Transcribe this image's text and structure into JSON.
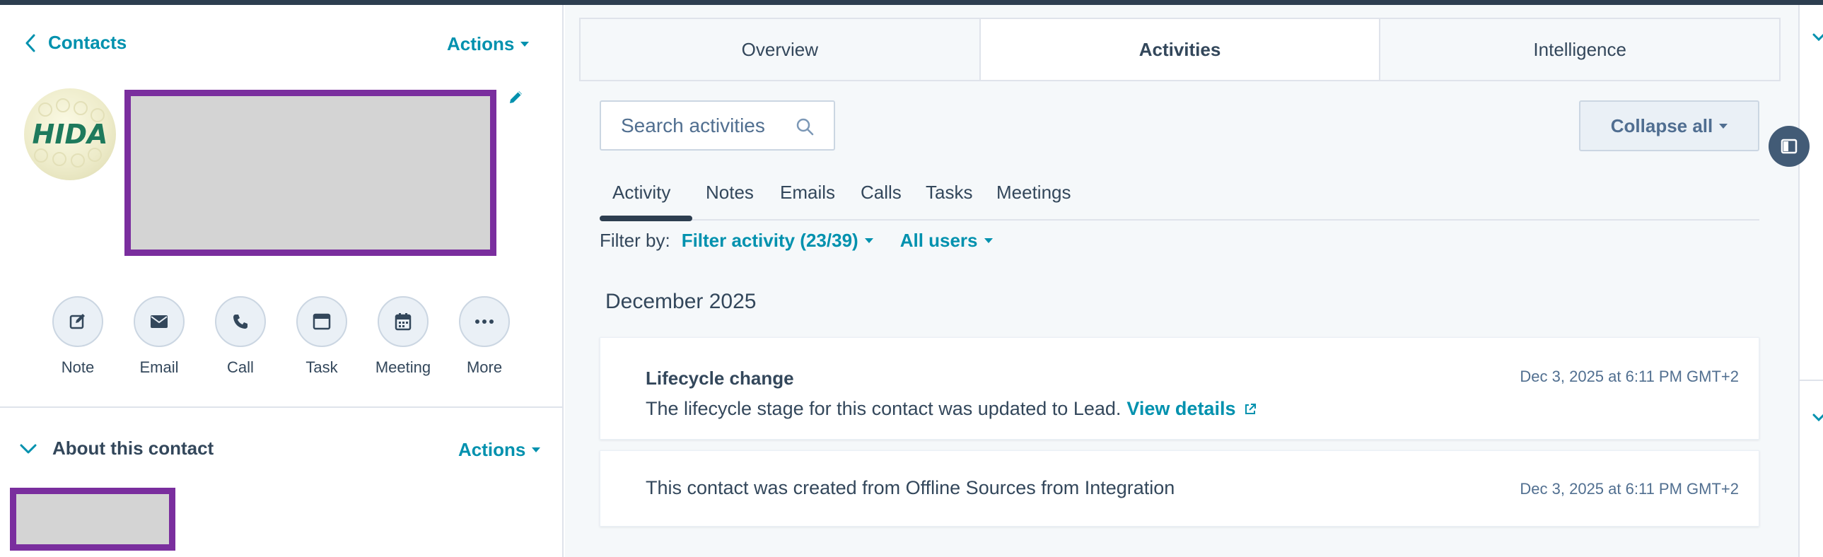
{
  "left_panel": {
    "back_label": "Contacts",
    "header_actions_label": "Actions",
    "logo_text": "HIDA",
    "quick_actions": [
      {
        "label": "Note",
        "icon": "note-icon"
      },
      {
        "label": "Email",
        "icon": "email-icon"
      },
      {
        "label": "Call",
        "icon": "phone-icon"
      },
      {
        "label": "Task",
        "icon": "task-icon"
      },
      {
        "label": "Meeting",
        "icon": "calendar-icon"
      },
      {
        "label": "More",
        "icon": "more-icon"
      }
    ],
    "about_section": {
      "title": "About this contact",
      "actions_label": "Actions"
    }
  },
  "main_tabs": [
    {
      "label": "Overview",
      "active": false
    },
    {
      "label": "Activities",
      "active": true
    },
    {
      "label": "Intelligence",
      "active": false
    }
  ],
  "activities": {
    "search_placeholder": "Search activities",
    "collapse_label": "Collapse all",
    "subtabs": [
      "Activity",
      "Notes",
      "Emails",
      "Calls",
      "Tasks",
      "Meetings"
    ],
    "active_subtab": "Activity",
    "filter": {
      "label": "Filter by:",
      "activity_filter": "Filter activity (23/39)",
      "users_filter": "All users"
    },
    "month_header": "December 2025",
    "items": [
      {
        "title": "Lifecycle change",
        "body": "The lifecycle stage for this contact was updated to Lead.",
        "link_label": "View details",
        "date": "Dec 3, 2025 at 6:11 PM GMT+2"
      },
      {
        "body": "This contact was created from Offline Sources from Integration",
        "date": "Dec 3, 2025 at 6:11 PM GMT+2"
      }
    ]
  },
  "colors": {
    "accent": "#0091ae",
    "text": "#33475b",
    "redaction_border": "#7a2e9e",
    "topbar": "#2d3e50"
  }
}
